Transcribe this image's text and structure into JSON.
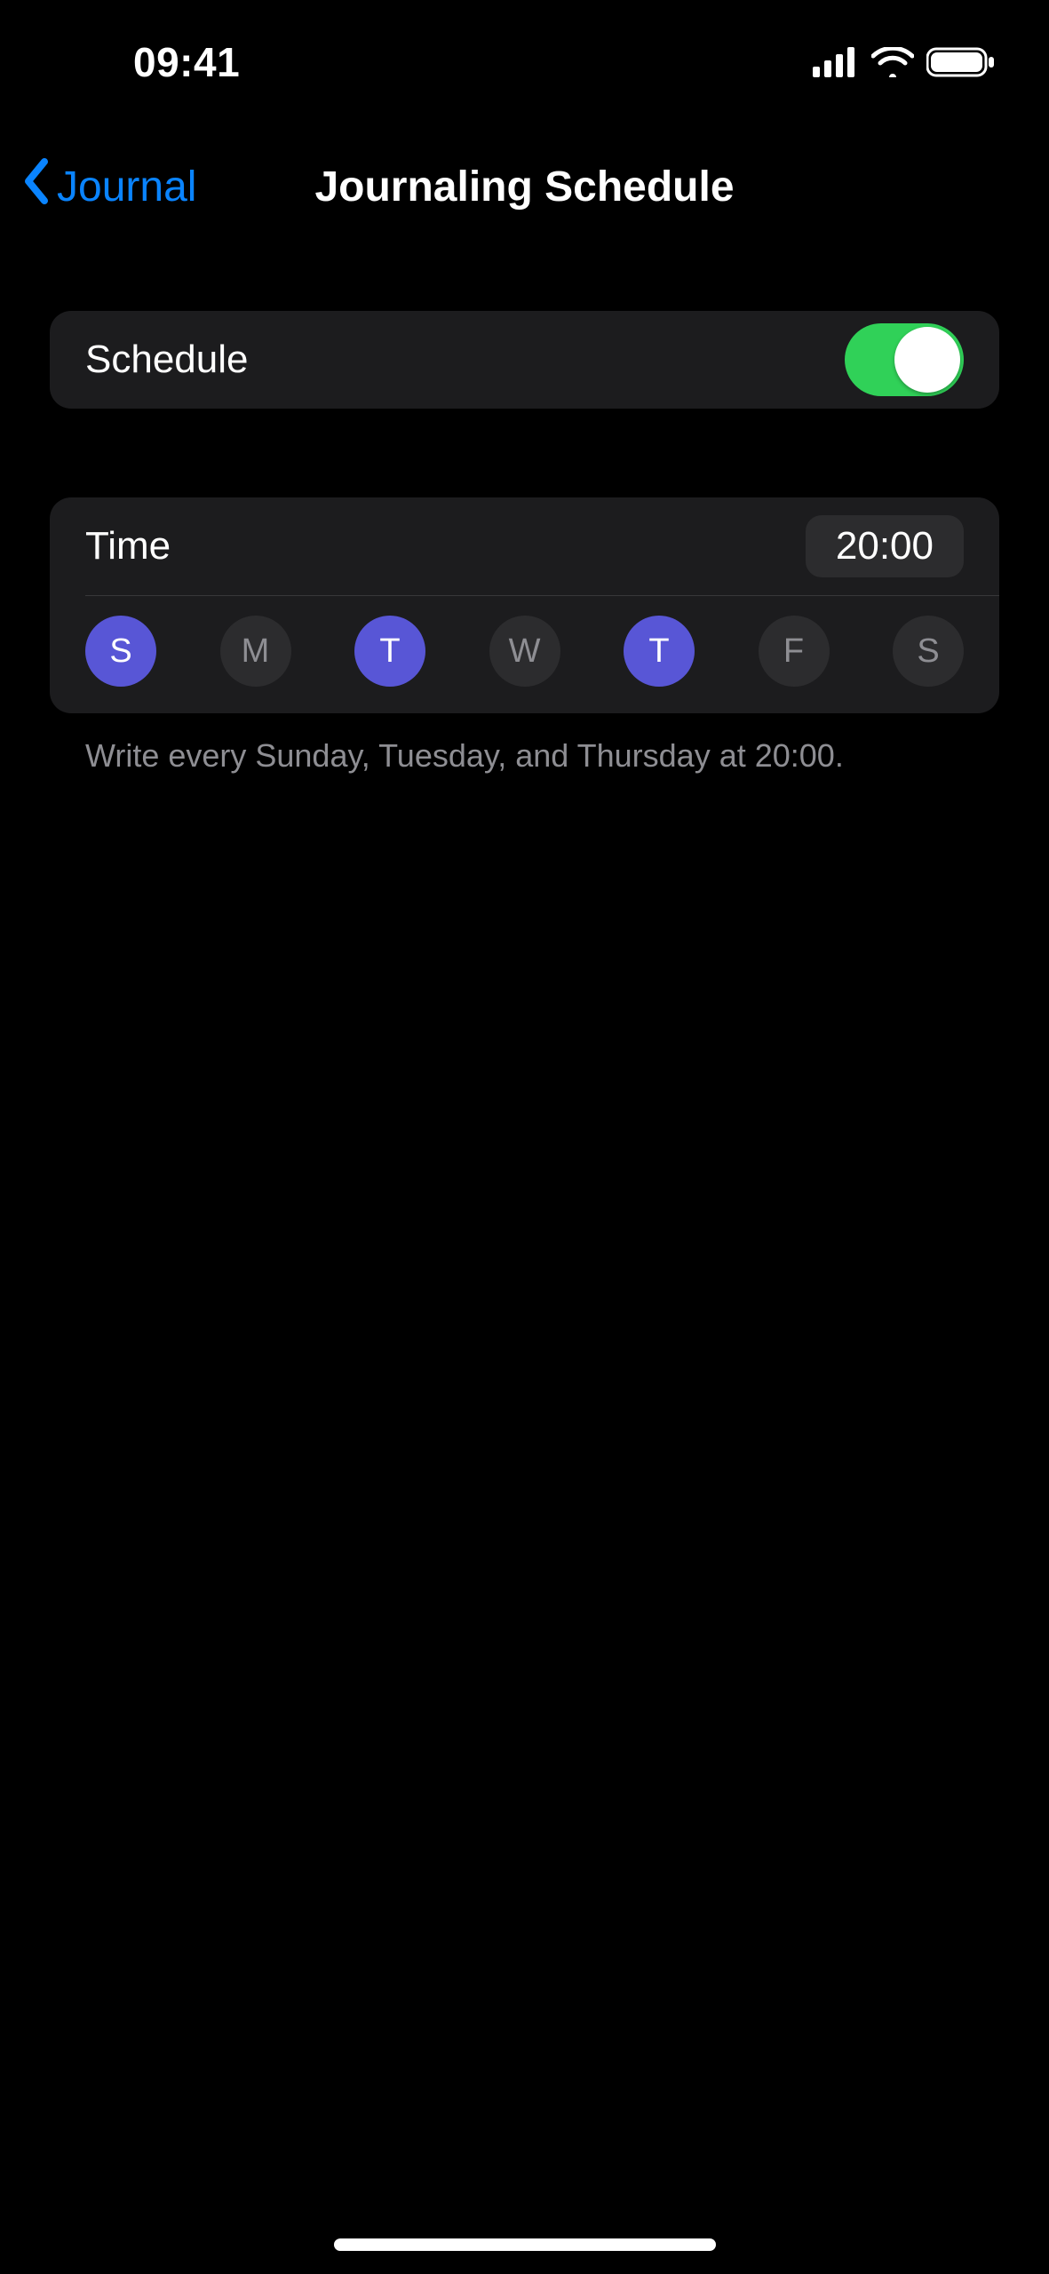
{
  "status": {
    "time": "09:41"
  },
  "nav": {
    "back_label": "Journal",
    "title": "Journaling Schedule"
  },
  "schedule": {
    "toggle_label": "Schedule",
    "toggle_on": true,
    "time_label": "Time",
    "time_value": "20:00",
    "days": [
      {
        "abbr": "S",
        "selected": true
      },
      {
        "abbr": "M",
        "selected": false
      },
      {
        "abbr": "T",
        "selected": true
      },
      {
        "abbr": "W",
        "selected": false
      },
      {
        "abbr": "T",
        "selected": true
      },
      {
        "abbr": "F",
        "selected": false
      },
      {
        "abbr": "S",
        "selected": false
      }
    ],
    "summary": "Write every Sunday, Tuesday, and Thursday at 20:00."
  },
  "colors": {
    "accent_blue": "#0a84ff",
    "accent_indigo": "#5856d6",
    "toggle_green": "#30d158"
  }
}
